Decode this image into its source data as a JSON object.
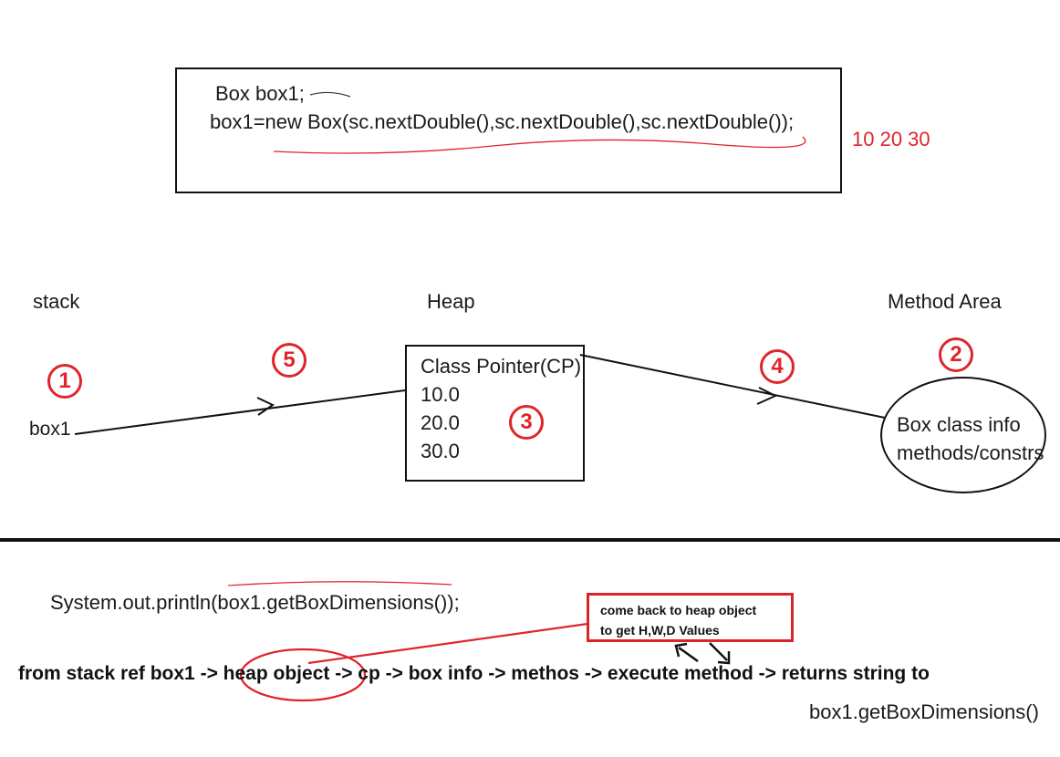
{
  "code": {
    "line1": "Box box1;",
    "line2": "box1=new Box(sc.nextDouble(),sc.nextDouble(),sc.nextDouble());",
    "inputs": "10 20 30"
  },
  "sections": {
    "stack": "stack",
    "heap": "Heap",
    "method_area": "Method Area"
  },
  "stack_var": "box1",
  "heap_object": {
    "lines": [
      "Class Pointer(CP)",
      "10.0",
      "20.0",
      "30.0"
    ]
  },
  "method_area_box": {
    "lines": [
      "Box class info",
      "methods/constrs"
    ]
  },
  "badges": [
    "1",
    "2",
    "3",
    "4",
    "5"
  ],
  "bottom": {
    "println": "System.out.println(box1.getBoxDimensions());",
    "callout_line1": "come back to heap object",
    "callout_line2": "to get H,W,D Values",
    "flow_before": "from stack ref box1 -> ",
    "flow_highlight": "heap object",
    "flow_after": " -> cp -> box info -> methos -> execute method -> returns string to",
    "result": "box1.getBoxDimensions()"
  },
  "colors": {
    "accent_red": "#e0242a",
    "ink": "#111111"
  }
}
